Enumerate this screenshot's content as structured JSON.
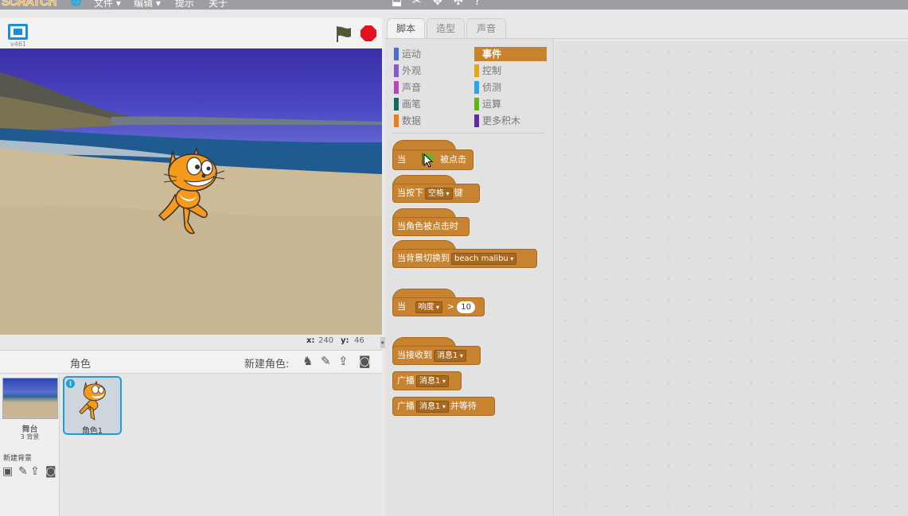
{
  "menubar": {
    "logo": "SCRATCH",
    "items": [
      "文件 ▾",
      "编辑 ▾",
      "提示",
      "关于"
    ],
    "globe_icon": "globe-icon",
    "tools": [
      "stamp-icon",
      "cut-icon",
      "grow-icon",
      "shrink-icon",
      "help-icon"
    ]
  },
  "stage": {
    "version": "v461",
    "x_label": "x:",
    "x_value": "240",
    "y_label": "y:",
    "y_value": "46"
  },
  "sprites": {
    "header": "角色",
    "new_sprite_label": "新建角色:",
    "stage_name": "舞台",
    "stage_backdrops": "3 背景",
    "new_backdrop_label": "新建背景",
    "sprite_name": "角色1",
    "info_badge": "i"
  },
  "tabs": [
    "脚本",
    "造型",
    "声音"
  ],
  "categories": {
    "left": [
      {
        "label": "运动",
        "color": "#4a6cd4"
      },
      {
        "label": "外观",
        "color": "#8a55d7"
      },
      {
        "label": "声音",
        "color": "#bb42c3"
      },
      {
        "label": "画笔",
        "color": "#0e9a6c"
      },
      {
        "label": "数据",
        "color": "#ee7d16"
      }
    ],
    "right": [
      {
        "label": "事件",
        "color": "#c88330"
      },
      {
        "label": "控制",
        "color": "#e1a91a"
      },
      {
        "label": "侦测",
        "color": "#2ca5e2"
      },
      {
        "label": "运算",
        "color": "#5cb712"
      },
      {
        "label": "更多积木",
        "color": "#632d99"
      }
    ]
  },
  "blocks": {
    "flag_clicked_pre": "当",
    "flag_clicked_post": "被点击",
    "key_pressed_pre": "当按下",
    "key_pressed_key": "空格",
    "key_pressed_post": "键",
    "sprite_clicked": "当角色被点击时",
    "backdrop_switch_pre": "当背景切换到",
    "backdrop_switch_value": "beach malibu",
    "sensor_pre": "当",
    "sensor_value": "响度",
    "sensor_op": ">",
    "sensor_num": "10",
    "receive_pre": "当接收到",
    "receive_msg": "消息1",
    "broadcast_pre": "广播",
    "broadcast_msg": "消息1",
    "broadcast_wait_pre": "广播",
    "broadcast_wait_msg": "消息1",
    "broadcast_wait_post": "并等待"
  }
}
